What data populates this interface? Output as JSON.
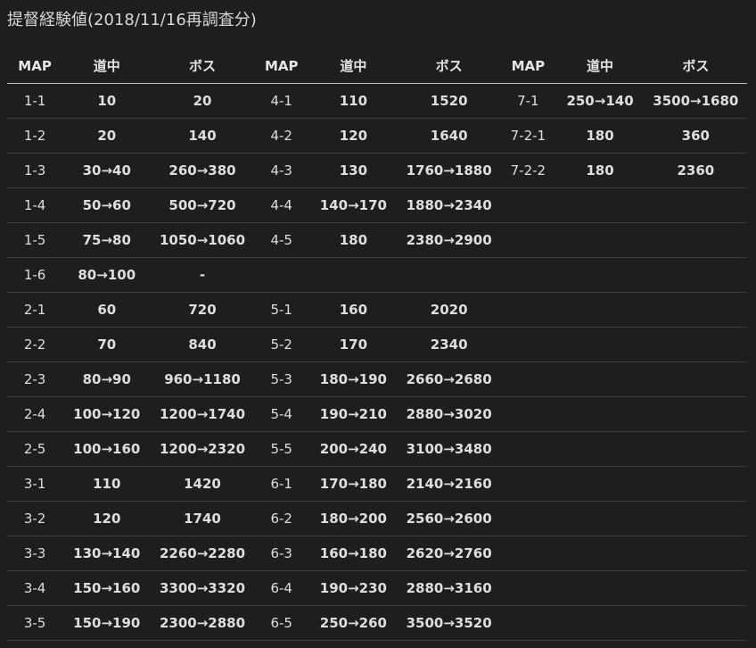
{
  "page_title": "提督経験値(2018/11/16再調査分)",
  "headers": [
    "MAP",
    "道中",
    "ボス",
    "MAP",
    "道中",
    "ボス",
    "MAP",
    "道中",
    "ボス"
  ],
  "rows": [
    [
      "1-1",
      "10",
      "20",
      "4-1",
      "110",
      "1520",
      "7-1",
      "250→140",
      "3500→1680"
    ],
    [
      "1-2",
      "20",
      "140",
      "4-2",
      "120",
      "1640",
      "7-2-1",
      "180",
      "360"
    ],
    [
      "1-3",
      "30→40",
      "260→380",
      "4-3",
      "130",
      "1760→1880",
      "7-2-2",
      "180",
      "2360"
    ],
    [
      "1-4",
      "50→60",
      "500→720",
      "4-4",
      "140→170",
      "1880→2340",
      "",
      "",
      ""
    ],
    [
      "1-5",
      "75→80",
      "1050→1060",
      "4-5",
      "180",
      "2380→2900",
      "",
      "",
      ""
    ],
    [
      "1-6",
      "80→100",
      "-",
      "",
      "",
      "",
      "",
      "",
      ""
    ],
    [
      "2-1",
      "60",
      "720",
      "5-1",
      "160",
      "2020",
      "",
      "",
      ""
    ],
    [
      "2-2",
      "70",
      "840",
      "5-2",
      "170",
      "2340",
      "",
      "",
      ""
    ],
    [
      "2-3",
      "80→90",
      "960→1180",
      "5-3",
      "180→190",
      "2660→2680",
      "",
      "",
      ""
    ],
    [
      "2-4",
      "100→120",
      "1200→1740",
      "5-4",
      "190→210",
      "2880→3020",
      "",
      "",
      ""
    ],
    [
      "2-5",
      "100→160",
      "1200→2320",
      "5-5",
      "200→240",
      "3100→3480",
      "",
      "",
      ""
    ],
    [
      "3-1",
      "110",
      "1420",
      "6-1",
      "170→180",
      "2140→2160",
      "",
      "",
      ""
    ],
    [
      "3-2",
      "120",
      "1740",
      "6-2",
      "180→200",
      "2560→2600",
      "",
      "",
      ""
    ],
    [
      "3-3",
      "130→140",
      "2260→2280",
      "6-3",
      "160→180",
      "2620→2760",
      "",
      "",
      ""
    ],
    [
      "3-4",
      "150→160",
      "3300→3320",
      "6-4",
      "190→230",
      "2880→3160",
      "",
      "",
      ""
    ],
    [
      "3-5",
      "150→190",
      "2300→2880",
      "6-5",
      "250→260",
      "3500→3520",
      "",
      "",
      ""
    ]
  ]
}
